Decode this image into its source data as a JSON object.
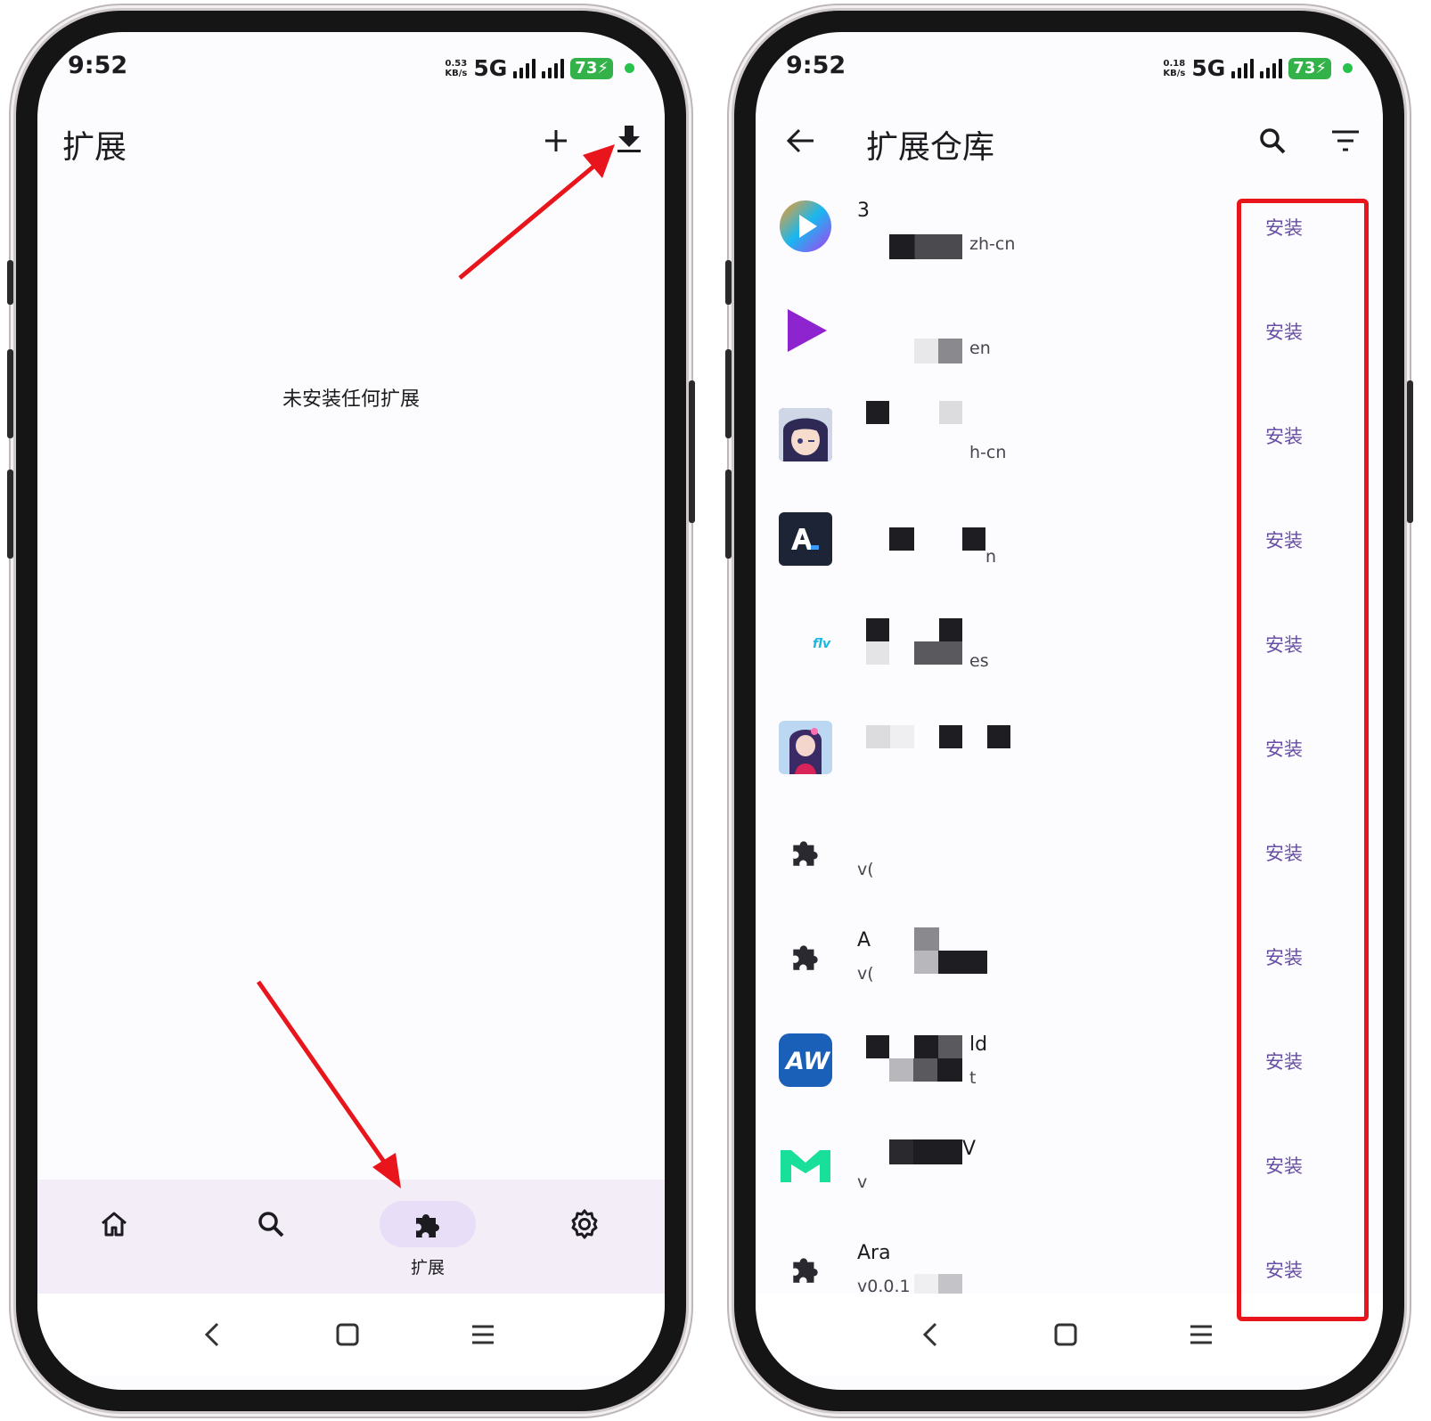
{
  "left_screen": {
    "status_bar": {
      "time": "9:52",
      "speed_value": "0.53",
      "speed_unit": "KB/s",
      "network": "5G",
      "battery": "73"
    },
    "app_bar": {
      "title": "扩展",
      "add_icon": "plus-icon",
      "download_icon": "download-icon"
    },
    "empty_message": "未安装任何扩展",
    "bottom_nav": {
      "items": [
        {
          "icon": "home-icon",
          "label": ""
        },
        {
          "icon": "search-icon",
          "label": ""
        },
        {
          "icon": "puzzle-icon",
          "label": "扩展",
          "active": true
        },
        {
          "icon": "gear-icon",
          "label": ""
        }
      ]
    },
    "system_nav": [
      "back-icon",
      "home-square-icon",
      "menu-icon"
    ]
  },
  "right_screen": {
    "status_bar": {
      "time": "9:52",
      "speed_value": "0.18",
      "speed_unit": "KB/s",
      "network": "5G",
      "battery": "73"
    },
    "app_bar": {
      "title": "扩展仓库",
      "back_icon": "arrow-left-icon",
      "search_icon": "search-icon",
      "filter_icon": "filter-icon"
    },
    "install_label": "安装",
    "extensions": [
      {
        "icon": "play-gradient-icon",
        "name": "3",
        "sub": "zh-cn"
      },
      {
        "icon": "play-purple-icon",
        "name": "",
        "sub": "en"
      },
      {
        "icon": "anime-avatar-icon",
        "name": "",
        "sub": "h-cn"
      },
      {
        "icon": "al-logo-icon",
        "name": "",
        "sub": "n"
      },
      {
        "icon": "flv-logo-icon",
        "name": "",
        "sub": "es"
      },
      {
        "icon": "anime-avatar-2-icon",
        "name": "",
        "sub": ""
      },
      {
        "icon": "puzzle-icon",
        "name": "",
        "sub": "v("
      },
      {
        "icon": "puzzle-icon",
        "name": "A",
        "sub": "v("
      },
      {
        "icon": "aw-logo-icon",
        "name": "ld",
        "sub": "t"
      },
      {
        "icon": "m-logo-icon",
        "name": "V",
        "sub": "v"
      },
      {
        "icon": "puzzle-icon",
        "name": "Ara",
        "sub": "v0.0.1"
      }
    ],
    "colors": {
      "accent": "#6750a4",
      "highlight_box": "#e8161c"
    }
  }
}
